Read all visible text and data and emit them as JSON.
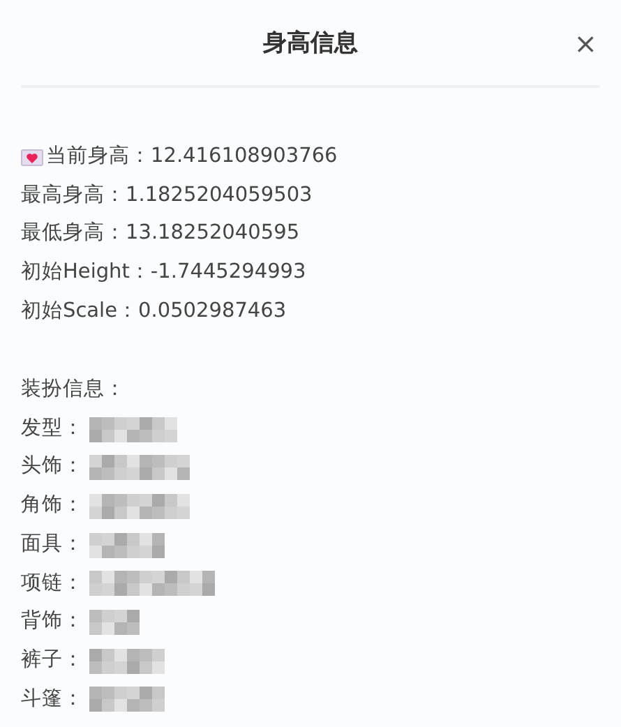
{
  "dialog": {
    "title": "身高信息",
    "close": "×"
  },
  "height_info": [
    {
      "kind": "current",
      "text": "当前身高：12.416108903766"
    },
    {
      "kind": "plain",
      "text": "最高身高：1.1825204059503"
    },
    {
      "kind": "plain",
      "text": "最低身高：13.18252040595"
    },
    {
      "kind": "plain",
      "text": "初始Height：-1.7445294993"
    },
    {
      "kind": "plain",
      "text": "初始Scale：0.0502987463"
    }
  ],
  "outfit": {
    "heading": "装扮信息：",
    "items": [
      {
        "label": "发型："
      },
      {
        "label": "头饰："
      },
      {
        "label": "角饰："
      },
      {
        "label": "面具："
      },
      {
        "label": "项链："
      },
      {
        "label": "背饰："
      },
      {
        "label": "裤子："
      },
      {
        "label": "斗篷："
      }
    ]
  }
}
